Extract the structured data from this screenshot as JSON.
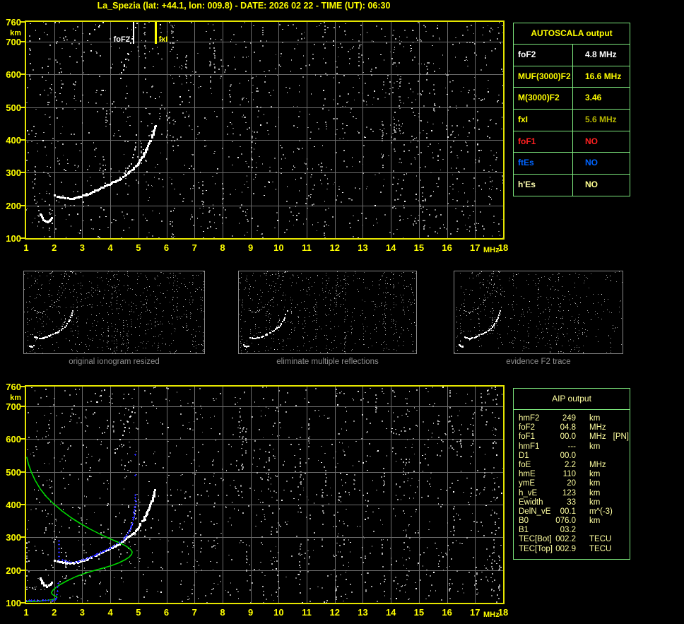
{
  "title": "La_Spezia (lat: +44.1, lon: 009.8) - DATE: 2026 02 22 - TIME (UT): 06:30",
  "colors": {
    "accent_yellow": "#ffff00",
    "frame_yellow": "#e6e600",
    "pale_yellow": "#ffffa0",
    "table_border_green": "#7de87d",
    "grid_gray": "#6c6c6c",
    "caption_gray": "#8f8f8f",
    "profile_green": "#00d800",
    "restored_trace_blue": "#2828ff",
    "value_olive": "#b8b800",
    "status_red": "#ff2020",
    "status_blue": "#0064ff",
    "trace_white": "#ffffff"
  },
  "autoscala": {
    "header": "AUTOSCALA output",
    "rows": [
      {
        "label": "foF2",
        "value": "4.8 MHz",
        "color": "#ffffff",
        "value_color": "#ffffff"
      },
      {
        "label": "MUF(3000)F2",
        "value": "16.6 MHz",
        "color": "#ffff00",
        "value_color": "#ffff00"
      },
      {
        "label": "M(3000)F2",
        "value": "3.46",
        "color": "#ffff00",
        "value_color": "#ffff00"
      },
      {
        "label": "fxI",
        "value": "5.6 MHz",
        "color": "#ffff00",
        "value_color": "#b8b800"
      },
      {
        "label": "foF1",
        "value": "NO",
        "color": "#ff2020",
        "value_color": "#ff2020"
      },
      {
        "label": "ftEs",
        "value": "NO",
        "color": "#0064ff",
        "value_color": "#0064ff"
      },
      {
        "label": "h'Es",
        "value": "NO",
        "color": "#ffffb0",
        "value_color": "#ffff90"
      }
    ]
  },
  "aip": {
    "header": "AIP output",
    "rows": [
      {
        "label": "hmF2",
        "value": "249",
        "unit": "km",
        "extra": ""
      },
      {
        "label": "foF2",
        "value": "04.8",
        "unit": "MHz",
        "extra": ""
      },
      {
        "label": "foF1",
        "value": "00.0",
        "unit": "MHz",
        "extra": "[PN]"
      },
      {
        "label": "hmF1",
        "value": "---",
        "unit": "km",
        "extra": ""
      },
      {
        "label": "D1",
        "value": "00.0",
        "unit": "",
        "extra": ""
      },
      {
        "label": "foE",
        "value": "2.2",
        "unit": "MHz",
        "extra": ""
      },
      {
        "label": "hmE",
        "value": "110",
        "unit": "km",
        "extra": ""
      },
      {
        "label": "ymE",
        "value": "20",
        "unit": "km",
        "extra": ""
      },
      {
        "label": "h_vE",
        "value": "123",
        "unit": "km",
        "extra": ""
      },
      {
        "label": "Ewidth",
        "value": "33",
        "unit": "km",
        "extra": ""
      },
      {
        "label": "DelN_vE",
        "value": "00.1",
        "unit": "m^(-3)",
        "extra": ""
      },
      {
        "label": "B0",
        "value": "076.0",
        "unit": "km",
        "extra": ""
      },
      {
        "label": "B1",
        "value": "03.2",
        "unit": "",
        "extra": ""
      },
      {
        "label": "TEC[Bot]",
        "value": "002.2",
        "unit": "TECU",
        "extra": ""
      },
      {
        "label": "TEC[Top]",
        "value": "002.9",
        "unit": "TECU",
        "extra": ""
      }
    ]
  },
  "panels": [
    {
      "caption": "original ionogram resized"
    },
    {
      "caption": "eliminate multiple reflections"
    },
    {
      "caption": "evidence F2 trace"
    }
  ],
  "chart_data": [
    {
      "type": "scatter",
      "title": "ionogram - virtual height vs frequency",
      "xlabel": "MHz",
      "ylabel": "km",
      "xlim": [
        1,
        18
      ],
      "ylim": [
        100,
        760
      ],
      "x_ticks": [
        1,
        2,
        3,
        4,
        5,
        6,
        7,
        8,
        9,
        10,
        11,
        12,
        13,
        14,
        15,
        16,
        17,
        18
      ],
      "y_ticks": [
        760,
        700,
        600,
        500,
        400,
        300,
        200,
        100
      ],
      "grid": true,
      "markers": [
        {
          "label": "foF2",
          "freq": 4.8,
          "color": "#ffffff"
        },
        {
          "label": "fxI",
          "freq": 5.6,
          "color": "#ffff00"
        }
      ],
      "traces": {
        "e_layer": [
          [
            1.5,
            175
          ],
          [
            1.56,
            163
          ],
          [
            1.64,
            155
          ],
          [
            1.74,
            152
          ],
          [
            1.83,
            156
          ],
          [
            1.9,
            163
          ]
        ],
        "f_main": [
          [
            2.0,
            232
          ],
          [
            2.1,
            229
          ],
          [
            2.25,
            226
          ],
          [
            2.4,
            223
          ],
          [
            2.55,
            222
          ],
          [
            2.7,
            224
          ],
          [
            2.85,
            227
          ],
          [
            3.0,
            231
          ],
          [
            3.15,
            235
          ],
          [
            3.3,
            240
          ],
          [
            3.5,
            248
          ],
          [
            3.7,
            256
          ],
          [
            3.9,
            264
          ],
          [
            4.05,
            270
          ],
          [
            4.2,
            277
          ],
          [
            4.35,
            284
          ],
          [
            4.5,
            293
          ],
          [
            4.65,
            303
          ],
          [
            4.8,
            313
          ],
          [
            4.95,
            327
          ],
          [
            5.06,
            341
          ],
          [
            5.19,
            358
          ],
          [
            5.29,
            374
          ],
          [
            5.38,
            392
          ],
          [
            5.46,
            410
          ],
          [
            5.53,
            428
          ],
          [
            5.58,
            446
          ]
        ],
        "f_o_branch": [
          [
            4.35,
            286
          ],
          [
            4.5,
            300
          ],
          [
            4.62,
            314
          ],
          [
            4.72,
            329
          ],
          [
            4.79,
            346
          ],
          [
            4.85,
            362
          ],
          [
            4.88,
            372
          ],
          [
            4.9,
            380
          ]
        ],
        "second_hops": [
          [
            [
              3.28,
              722
            ],
            [
              3.45,
              737
            ],
            [
              3.6,
              748
            ],
            [
              3.72,
              757
            ]
          ],
          [
            [
              4.35,
              590
            ],
            [
              4.5,
              628
            ],
            [
              4.62,
              662
            ],
            [
              4.73,
              694
            ],
            [
              4.83,
              722
            ],
            [
              4.9,
              742
            ],
            [
              4.96,
              758
            ]
          ]
        ]
      }
    },
    {
      "type": "scatter",
      "title": "ionogram with restored trace and electron density profile",
      "xlabel": "MHz",
      "ylabel": "km",
      "xlim": [
        1,
        18
      ],
      "ylim": [
        100,
        760
      ],
      "x_ticks": [
        1,
        2,
        3,
        4,
        5,
        6,
        7,
        8,
        9,
        10,
        11,
        12,
        13,
        14,
        15,
        16,
        17,
        18
      ],
      "y_ticks": [
        760,
        700,
        600,
        500,
        400,
        300,
        200,
        100
      ],
      "grid": true,
      "traces": {
        "e_layer": [
          [
            1.5,
            175
          ],
          [
            1.56,
            163
          ],
          [
            1.64,
            155
          ],
          [
            1.74,
            152
          ],
          [
            1.83,
            156
          ],
          [
            1.9,
            163
          ]
        ],
        "f_main": [
          [
            2.0,
            232
          ],
          [
            2.1,
            229
          ],
          [
            2.25,
            226
          ],
          [
            2.4,
            223
          ],
          [
            2.55,
            222
          ],
          [
            2.7,
            224
          ],
          [
            2.85,
            227
          ],
          [
            3.0,
            231
          ],
          [
            3.15,
            235
          ],
          [
            3.3,
            240
          ],
          [
            3.5,
            248
          ],
          [
            3.7,
            256
          ],
          [
            3.9,
            264
          ],
          [
            4.05,
            270
          ],
          [
            4.2,
            277
          ],
          [
            4.35,
            284
          ],
          [
            4.5,
            293
          ],
          [
            4.65,
            303
          ],
          [
            4.8,
            313
          ],
          [
            4.95,
            327
          ],
          [
            5.06,
            341
          ],
          [
            5.19,
            358
          ],
          [
            5.29,
            374
          ],
          [
            5.38,
            392
          ],
          [
            5.46,
            410
          ],
          [
            5.53,
            428
          ],
          [
            5.58,
            446
          ]
        ],
        "f_o_branch": [
          [
            4.35,
            286
          ],
          [
            4.5,
            300
          ],
          [
            4.62,
            314
          ],
          [
            4.72,
            329
          ],
          [
            4.79,
            346
          ],
          [
            4.85,
            362
          ],
          [
            4.88,
            372
          ],
          [
            4.9,
            380
          ]
        ],
        "second_hops": [
          [
            [
              3.33,
              690
            ],
            [
              3.5,
              712
            ],
            [
              3.63,
              733
            ],
            [
              3.76,
              752
            ]
          ],
          [
            [
              4.17,
              560
            ],
            [
              4.35,
              600
            ],
            [
              4.52,
              636
            ],
            [
              4.68,
              668
            ],
            [
              4.82,
              696
            ],
            [
              4.95,
              714
            ]
          ]
        ],
        "profile_green": [
          [
            1.02,
            545
          ],
          [
            1.08,
            524
          ],
          [
            1.18,
            500
          ],
          [
            1.32,
            474
          ],
          [
            1.5,
            448
          ],
          [
            1.72,
            424
          ],
          [
            1.98,
            402
          ],
          [
            2.28,
            380
          ],
          [
            2.6,
            360
          ],
          [
            2.95,
            341
          ],
          [
            3.3,
            324
          ],
          [
            3.65,
            309
          ],
          [
            3.95,
            297
          ],
          [
            4.25,
            286
          ],
          [
            4.5,
            276
          ],
          [
            4.65,
            268
          ],
          [
            4.74,
            261
          ],
          [
            4.78,
            255
          ],
          [
            4.76,
            248
          ],
          [
            4.68,
            240
          ],
          [
            4.52,
            231
          ],
          [
            4.3,
            222
          ],
          [
            4.05,
            214
          ],
          [
            3.75,
            206
          ],
          [
            3.45,
            199
          ],
          [
            3.1,
            190
          ],
          [
            2.75,
            179
          ],
          [
            2.45,
            167
          ],
          [
            2.2,
            155
          ],
          [
            2.05,
            146
          ],
          [
            1.95,
            138
          ],
          [
            1.9,
            131
          ],
          [
            1.93,
            126
          ],
          [
            2.0,
            122
          ],
          [
            2.08,
            119
          ],
          [
            2.1,
            116
          ],
          [
            2.03,
            112
          ],
          [
            1.9,
            109
          ],
          [
            1.7,
            107
          ],
          [
            1.45,
            105
          ],
          [
            1.2,
            104
          ],
          [
            1.02,
            104
          ]
        ],
        "blue_segments": [
          {
            "sparse": false,
            "pts": [
              [
                1.0,
                106
              ],
              [
                1.2,
                106
              ],
              [
                1.4,
                106
              ],
              [
                1.6,
                106
              ],
              [
                1.8,
                107
              ],
              [
                1.95,
                107
              ],
              [
                2.05,
                108
              ]
            ]
          },
          {
            "sparse": true,
            "pts": [
              [
                2.08,
                114
              ],
              [
                2.1,
                124
              ],
              [
                2.12,
                136
              ],
              [
                2.13,
                148
              ],
              [
                2.15,
                160
              ]
            ]
          },
          {
            "sparse": true,
            "pts": [
              [
                2.17,
                230
              ],
              [
                2.17,
                242
              ],
              [
                2.17,
                254
              ],
              [
                2.17,
                266
              ],
              [
                2.17,
                278
              ],
              [
                2.17,
                288
              ]
            ]
          },
          {
            "sparse": false,
            "pts": [
              [
                2.3,
                231
              ],
              [
                2.45,
                226
              ],
              [
                2.6,
                224
              ],
              [
                2.75,
                225
              ],
              [
                2.9,
                228
              ],
              [
                3.05,
                231
              ],
              [
                3.2,
                236
              ],
              [
                3.35,
                241
              ],
              [
                3.5,
                247
              ],
              [
                3.65,
                253
              ],
              [
                3.8,
                259
              ],
              [
                3.95,
                265
              ],
              [
                4.1,
                272
              ],
              [
                4.25,
                280
              ],
              [
                4.4,
                289
              ],
              [
                4.5,
                297
              ],
              [
                4.6,
                307
              ],
              [
                4.68,
                318
              ],
              [
                4.74,
                330
              ],
              [
                4.79,
                344
              ],
              [
                4.83,
                360
              ],
              [
                4.86,
                376
              ],
              [
                4.88,
                392
              ],
              [
                4.9,
                410
              ],
              [
                4.9,
                428
              ]
            ]
          },
          {
            "sparse": true,
            "pts": [
              [
                4.88,
                490
              ],
              [
                4.9,
                552
              ]
            ]
          }
        ]
      }
    }
  ]
}
